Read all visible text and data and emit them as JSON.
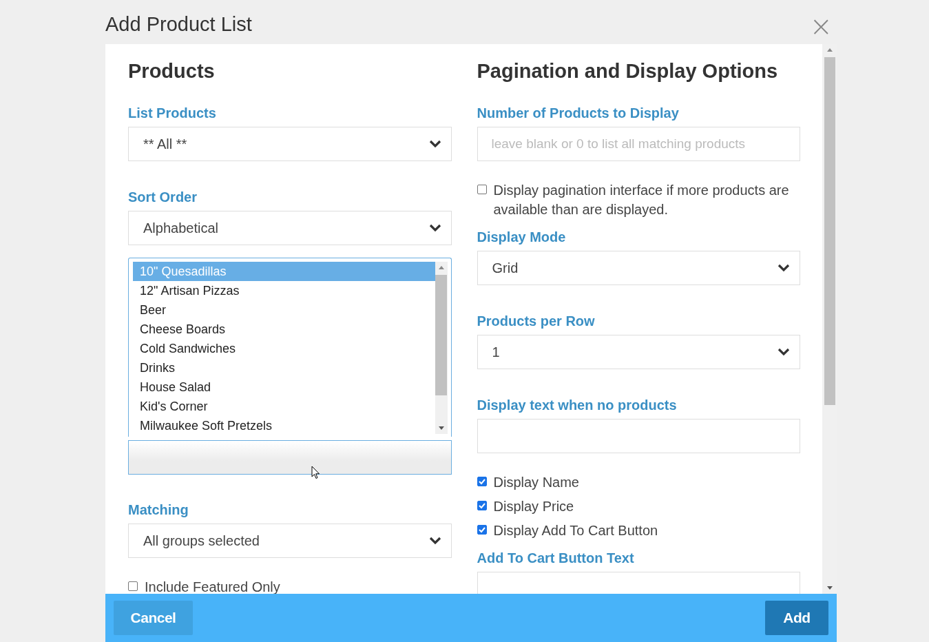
{
  "dialog": {
    "title": "Add Product List",
    "close": "×"
  },
  "columns": [
    {
      "heading": "Products",
      "items": [
        {
          "kind": "select",
          "label": "List Products",
          "value": "** All **"
        },
        {
          "kind": "select",
          "label": "Sort Order",
          "value": "Alphabetical"
        },
        {
          "kind": "listbox",
          "options": [
            {
              "label": "10\" Quesadillas",
              "selected": true
            },
            {
              "label": "12\" Artisan Pizzas",
              "selected": false
            },
            {
              "label": "Beer",
              "selected": false
            },
            {
              "label": "Cheese Boards",
              "selected": false
            },
            {
              "label": "Cold Sandwiches",
              "selected": false
            },
            {
              "label": "Drinks",
              "selected": false
            },
            {
              "label": "House Salad",
              "selected": false
            },
            {
              "label": "Kid's Corner",
              "selected": false
            },
            {
              "label": "Milwaukee Soft Pretzels",
              "selected": false
            }
          ]
        },
        {
          "kind": "search"
        },
        {
          "kind": "select",
          "label": "Matching",
          "value": "All groups selected"
        },
        {
          "kind": "checkbox",
          "label": "Include Featured Only",
          "checked": false
        }
      ]
    },
    {
      "heading": "Pagination and Display Options",
      "items": [
        {
          "kind": "input",
          "label": "Number of Products to Display",
          "placeholder": "leave blank or 0 to list all matching products"
        },
        {
          "kind": "checkbox",
          "label": "Display pagination interface if more products are available than are displayed.",
          "checked": false
        },
        {
          "kind": "select",
          "label": "Display Mode",
          "value": "Grid"
        },
        {
          "kind": "select",
          "label": "Products per Row",
          "value": "1"
        },
        {
          "kind": "input",
          "label": "Display text when no products"
        },
        {
          "kind": "checkbox",
          "label": "Display Name",
          "checked": true
        },
        {
          "kind": "checkbox",
          "label": "Display Price",
          "checked": true
        },
        {
          "kind": "checkbox",
          "label": "Display Add To Cart Button",
          "checked": true
        },
        {
          "kind": "input",
          "label": "Add To Cart Button Text"
        }
      ]
    }
  ],
  "buttons": [
    {
      "label": "Cancel",
      "kind": "secondary"
    },
    {
      "label": "Add",
      "kind": "primary"
    }
  ]
}
